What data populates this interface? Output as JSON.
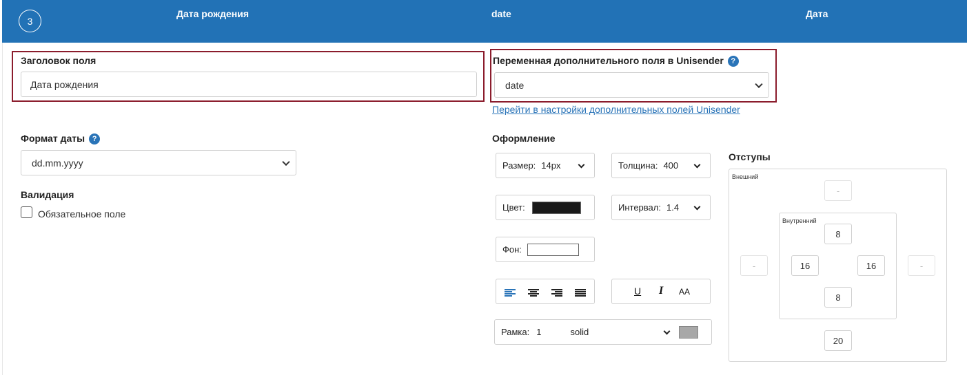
{
  "header": {
    "step_number": "3",
    "field_title": "Дата рождения",
    "variable": "date",
    "type": "Дата"
  },
  "field_title_block": {
    "label": "Заголовок поля",
    "value": "Дата рождения"
  },
  "variable_block": {
    "label": "Переменная дополнительного поля в Unisender",
    "help_icon": "?",
    "selected": "date",
    "settings_link": "Перейти в настройки дополнительных полей Unisender"
  },
  "date_format": {
    "label": "Формат даты",
    "help_icon": "?",
    "selected": "dd.mm.yyyy"
  },
  "validation": {
    "label": "Валидация",
    "required_label": "Обязательное поле",
    "required_checked": false
  },
  "styling": {
    "label": "Оформление",
    "size_label": "Размер:",
    "size_value": "14px",
    "weight_label": "Толщина:",
    "weight_value": "400",
    "color_label": "Цвет:",
    "color_value": "#1a1a1a",
    "spacing_label": "Интервал:",
    "spacing_value": "1.4",
    "background_label": "Фон:",
    "background_value": "#ffffff",
    "underline_label": "U",
    "italic_label": "I",
    "case_label": "AA",
    "border_label": "Рамка:",
    "border_width": "1",
    "border_style": "solid",
    "border_color": "#a8a8a8",
    "active_alignment": "left",
    "accent_color": "#2a74b8"
  },
  "spacing": {
    "label": "Отступы",
    "outer_label": "Внешний",
    "inner_label": "Внутренний",
    "outer_top": "-",
    "outer_left": "-",
    "outer_right": "-",
    "outer_bottom": "20",
    "inner_top": "8",
    "inner_left": "16",
    "inner_right": "16",
    "inner_bottom": "8"
  }
}
